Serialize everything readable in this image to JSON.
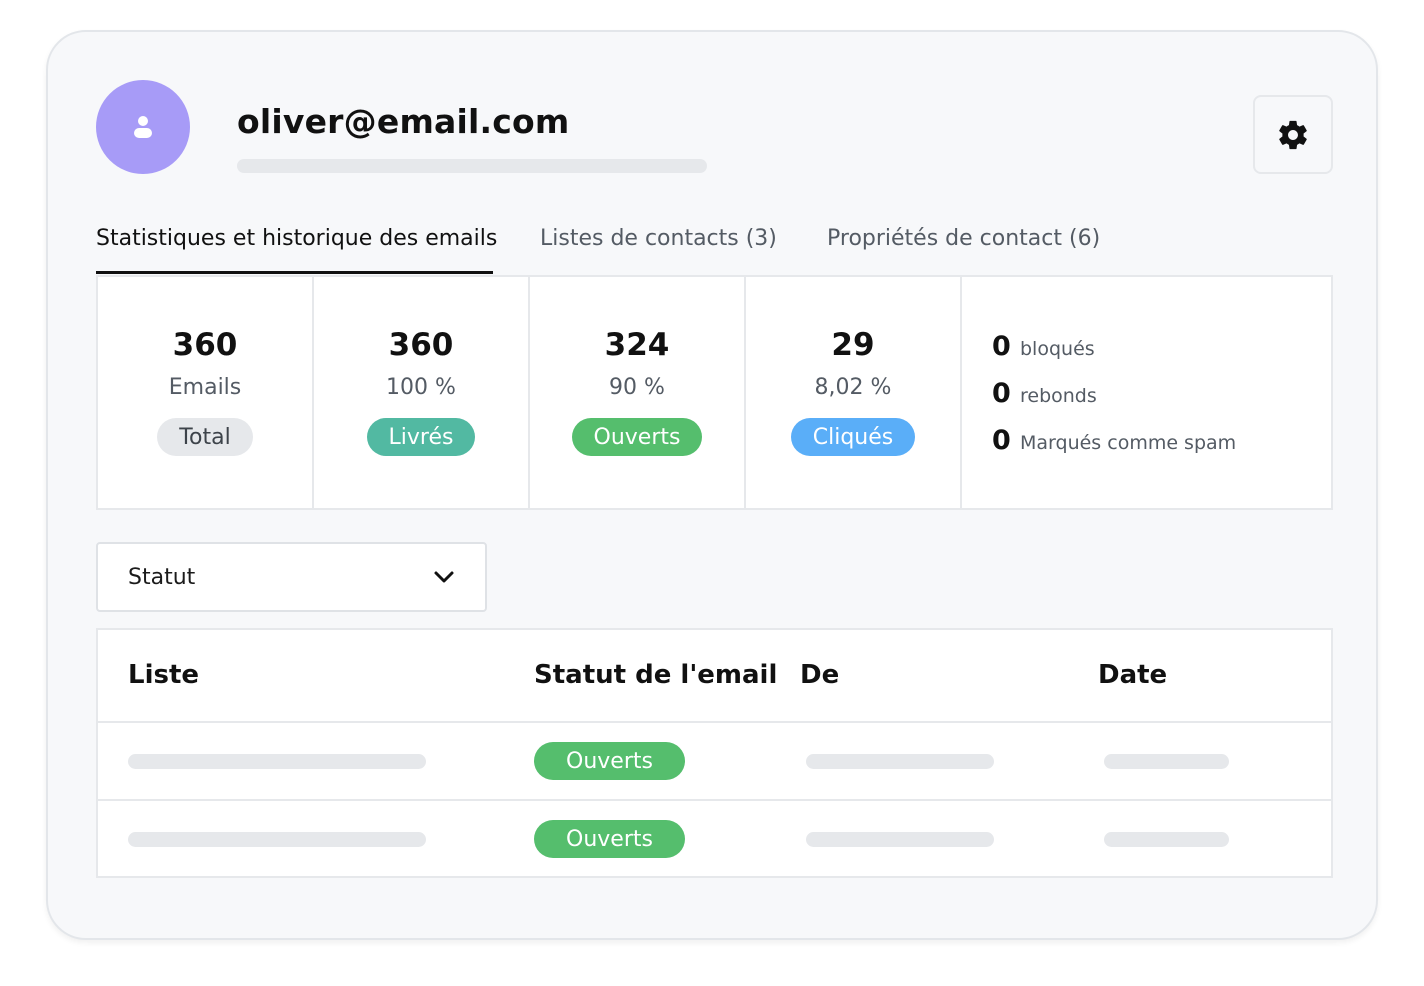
{
  "profile": {
    "email": "oliver@email.com"
  },
  "tabs": [
    {
      "label": "Statistiques et historique des emails",
      "active": true
    },
    {
      "label": "Listes de contacts (3)",
      "active": false
    },
    {
      "label": "Propriétés de contact (6)",
      "active": false
    }
  ],
  "stats": [
    {
      "value": "360",
      "caption": "Emails",
      "badge": "Total",
      "color": "#e6e8eb"
    },
    {
      "value": "360",
      "caption": "100 %",
      "badge": "Livrés",
      "color": "#52b9a2"
    },
    {
      "value": "324",
      "caption": "90 %",
      "badge": "Ouverts",
      "color": "#55be6d"
    },
    {
      "value": "29",
      "caption": "8,02 %",
      "badge": "Cliqués",
      "color": "#5aaef8"
    }
  ],
  "mini_stats": [
    {
      "value": "0",
      "label": "bloqués"
    },
    {
      "value": "0",
      "label": "rebonds"
    },
    {
      "value": "0",
      "label": "Marqués comme spam"
    }
  ],
  "filter": {
    "label": "Statut"
  },
  "table": {
    "columns": [
      "Liste",
      "Statut de l'email",
      "De",
      "Date"
    ],
    "rows": [
      {
        "status": "Ouverts"
      },
      {
        "status": "Ouverts"
      }
    ]
  },
  "colors": {
    "avatar": "#a79bf7",
    "opened": "#55be6d"
  },
  "icons": {
    "avatar": "user-icon",
    "settings": "gear-icon",
    "dropdown": "chevron-down-icon"
  }
}
